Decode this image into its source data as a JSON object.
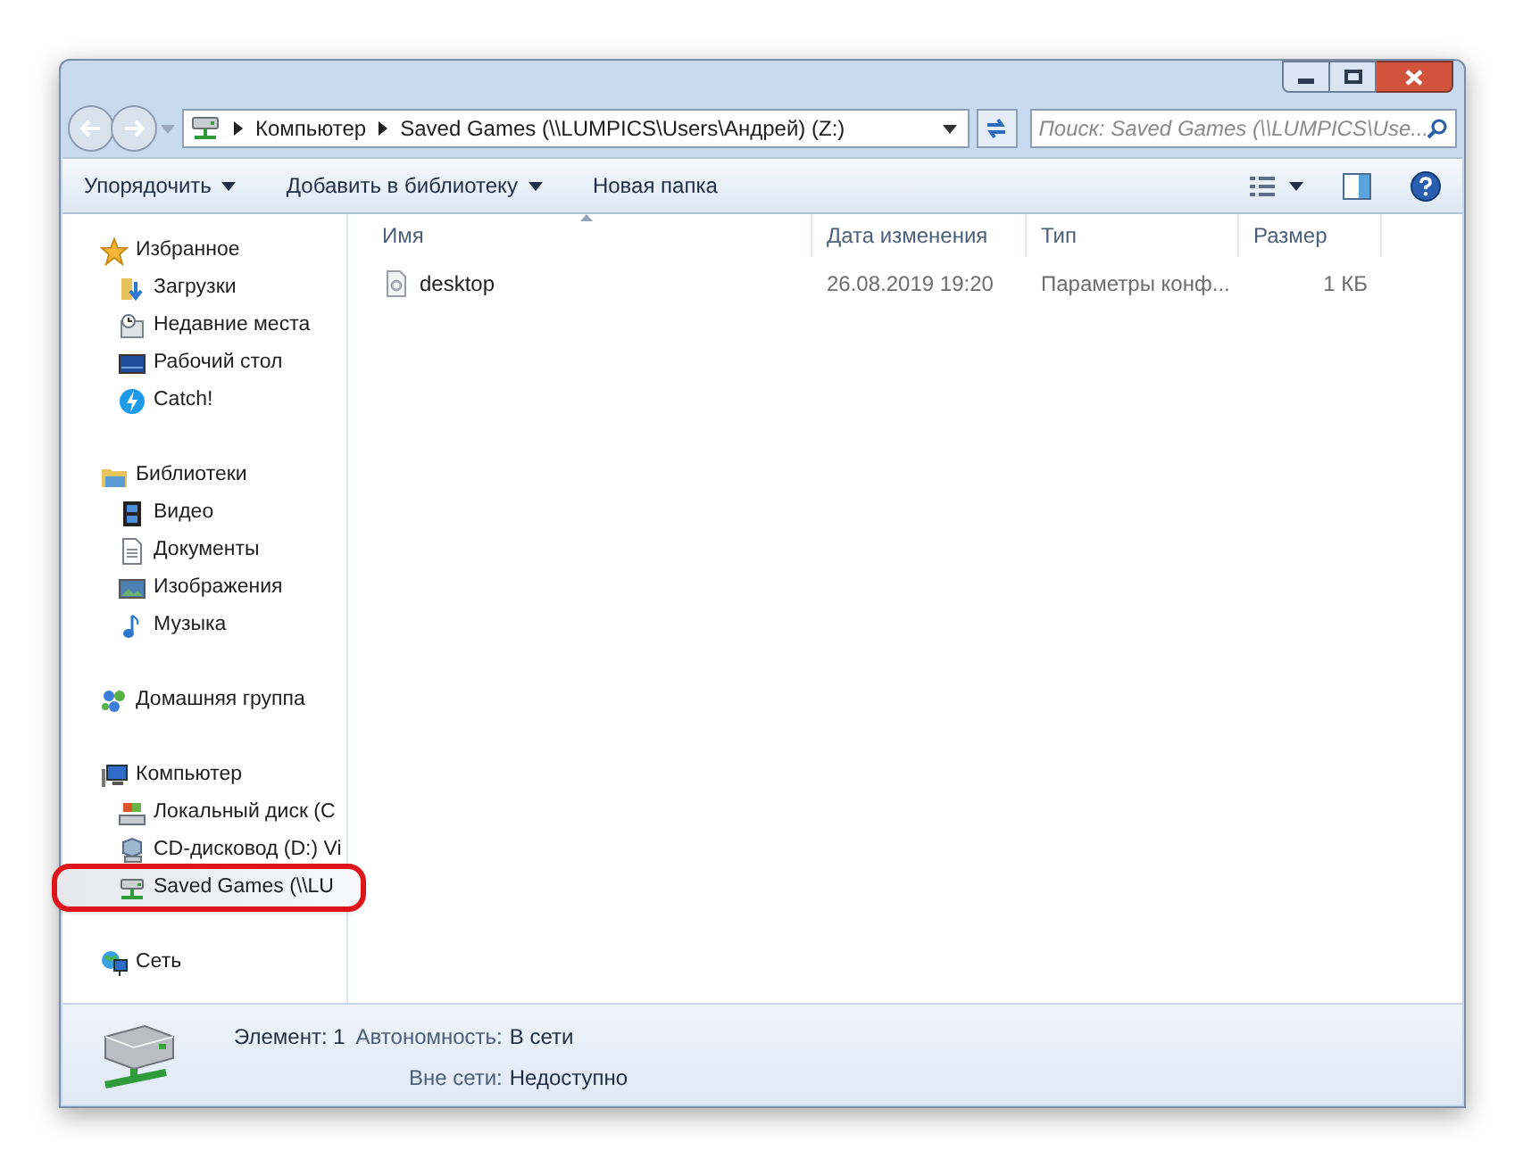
{
  "address_bar": {
    "segments": [
      "Компьютер",
      "Saved Games (\\\\LUMPICS\\Users\\Андрей) (Z:)"
    ]
  },
  "search": {
    "placeholder": "Поиск: Saved Games (\\\\LUMPICS\\Use..."
  },
  "toolbar": {
    "buttons": [
      {
        "label": "Упорядочить",
        "dropdown": true
      },
      {
        "label": "Добавить в библиотеку",
        "dropdown": true
      },
      {
        "label": "Новая папка",
        "dropdown": false
      }
    ]
  },
  "sidebar": {
    "groups": [
      {
        "label": "Избранное",
        "selected": false,
        "children": [
          {
            "label": "Загрузки",
            "selected": false
          },
          {
            "label": "Недавние места",
            "selected": false
          },
          {
            "label": "Рабочий стол",
            "selected": false
          },
          {
            "label": "Catch!",
            "selected": false
          }
        ]
      },
      {
        "label": "Библиотеки",
        "selected": false,
        "children": [
          {
            "label": "Видео",
            "selected": false
          },
          {
            "label": "Документы",
            "selected": false
          },
          {
            "label": "Изображения",
            "selected": false
          },
          {
            "label": "Музыка",
            "selected": false
          }
        ]
      },
      {
        "label": "Домашняя группа",
        "selected": false
      },
      {
        "label": "Компьютер",
        "selected": false,
        "children": [
          {
            "label": "Локальный диск (C",
            "selected": false
          },
          {
            "label": "CD-дисковод (D:) Vi",
            "selected": false
          },
          {
            "label": "Saved Games (\\\\LU",
            "selected": true,
            "highlighted": true
          }
        ]
      },
      {
        "label": "Сеть",
        "selected": false
      }
    ]
  },
  "table": {
    "columns": [
      {
        "label": "Имя",
        "sorted": true
      },
      {
        "label": "Дата изменения",
        "sorted": false
      },
      {
        "label": "Тип",
        "sorted": false
      },
      {
        "label": "Размер",
        "sorted": false
      }
    ],
    "rows": [
      {
        "cells": [
          "desktop",
          "26.08.2019 19:20",
          "Параметры конф...",
          "1 КБ"
        ]
      }
    ]
  },
  "status_bar": {
    "item_count": "Элемент: 1",
    "fields": [
      {
        "label": "Автономность:",
        "value": "В сети"
      },
      {
        "label": "Вне сети:",
        "value": "Недоступно"
      }
    ]
  }
}
